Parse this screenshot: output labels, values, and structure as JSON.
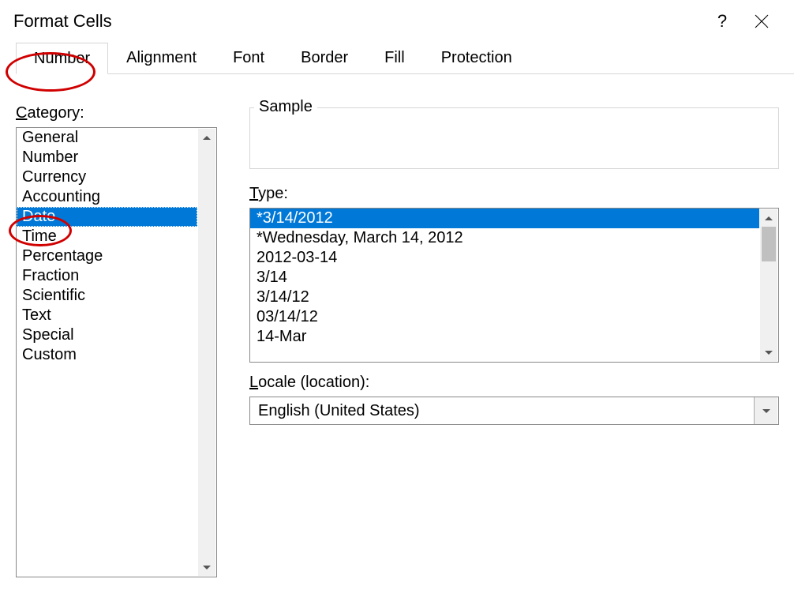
{
  "dialog": {
    "title": "Format Cells"
  },
  "tabs": {
    "items": [
      {
        "label": "Number",
        "active": true
      },
      {
        "label": "Alignment"
      },
      {
        "label": "Font"
      },
      {
        "label": "Border"
      },
      {
        "label": "Fill"
      },
      {
        "label": "Protection"
      }
    ]
  },
  "category": {
    "label": "Category:",
    "items": [
      "General",
      "Number",
      "Currency",
      "Accounting",
      "Date",
      "Time",
      "Percentage",
      "Fraction",
      "Scientific",
      "Text",
      "Special",
      "Custom"
    ],
    "selected_index": 4
  },
  "sample": {
    "label": "Sample",
    "value": ""
  },
  "type": {
    "label": "Type:",
    "items": [
      "*3/14/2012",
      "*Wednesday, March 14, 2012",
      "2012-03-14",
      "3/14",
      "3/14/12",
      "03/14/12",
      "14-Mar"
    ],
    "selected_index": 0
  },
  "locale": {
    "label": "Locale (location):",
    "value": "English (United States)"
  }
}
